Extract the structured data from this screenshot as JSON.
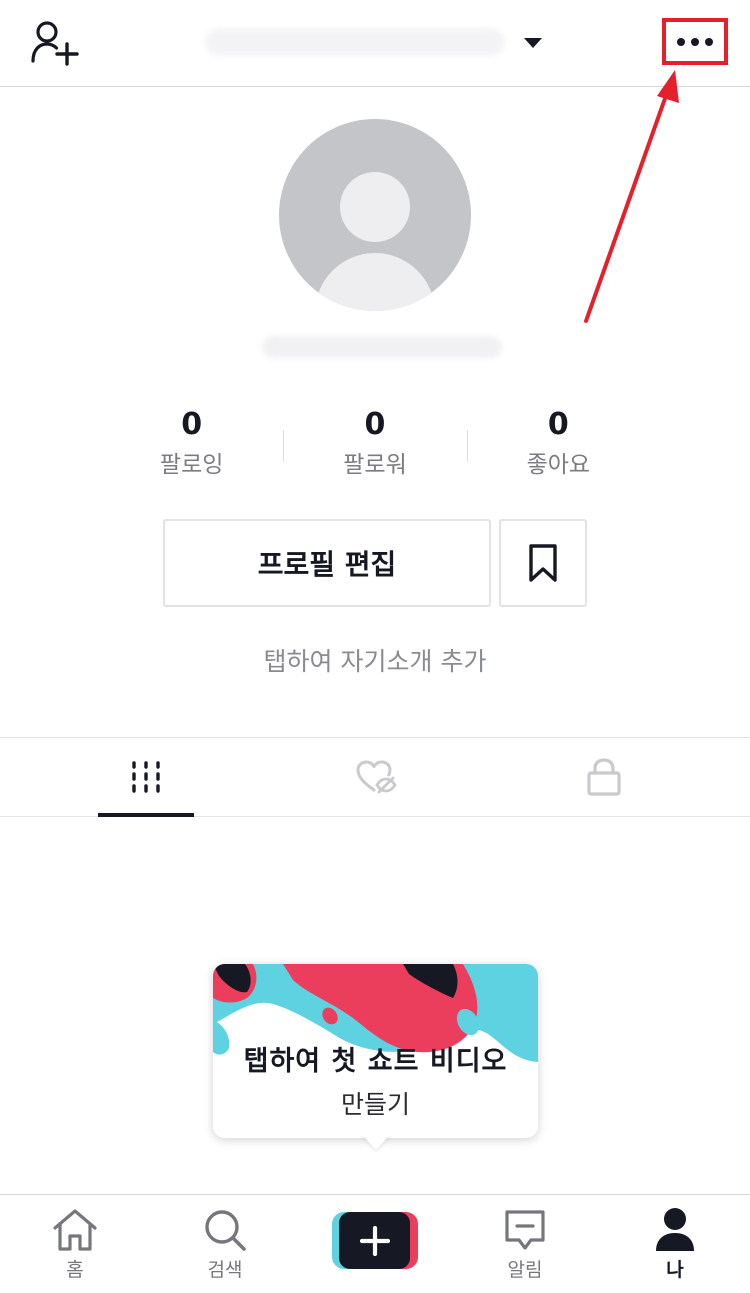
{
  "topbar": {
    "add_user_icon": "add-user-icon",
    "dropdown_icon": "caret-down-icon",
    "more_icon": "more-dots-icon",
    "highlight_color": "#e6202b"
  },
  "profile": {
    "avatar_icon": "default-avatar-icon",
    "stats": [
      {
        "value": "0",
        "label": "팔로잉"
      },
      {
        "value": "0",
        "label": "팔로워"
      },
      {
        "value": "0",
        "label": "좋아요"
      }
    ],
    "edit_button": "프로필 편집",
    "bookmark_icon": "bookmark-icon",
    "bio_prompt": "탭하여 자기소개 추가"
  },
  "tabs": [
    {
      "icon": "grid-icon",
      "active": true
    },
    {
      "icon": "liked-hidden-icon",
      "active": false
    },
    {
      "icon": "lock-icon",
      "active": false
    }
  ],
  "tooltip": {
    "line1": "탭하여 첫 쇼트 비디오",
    "line2": "만들기"
  },
  "bottom_nav": {
    "home": "홈",
    "search": "검색",
    "inbox": "알림",
    "me": "나"
  },
  "colors": {
    "text": "#161823",
    "muted": "#7b7c82",
    "brand_cyan": "#5fd2e1",
    "brand_pink": "#ea3e5c"
  }
}
